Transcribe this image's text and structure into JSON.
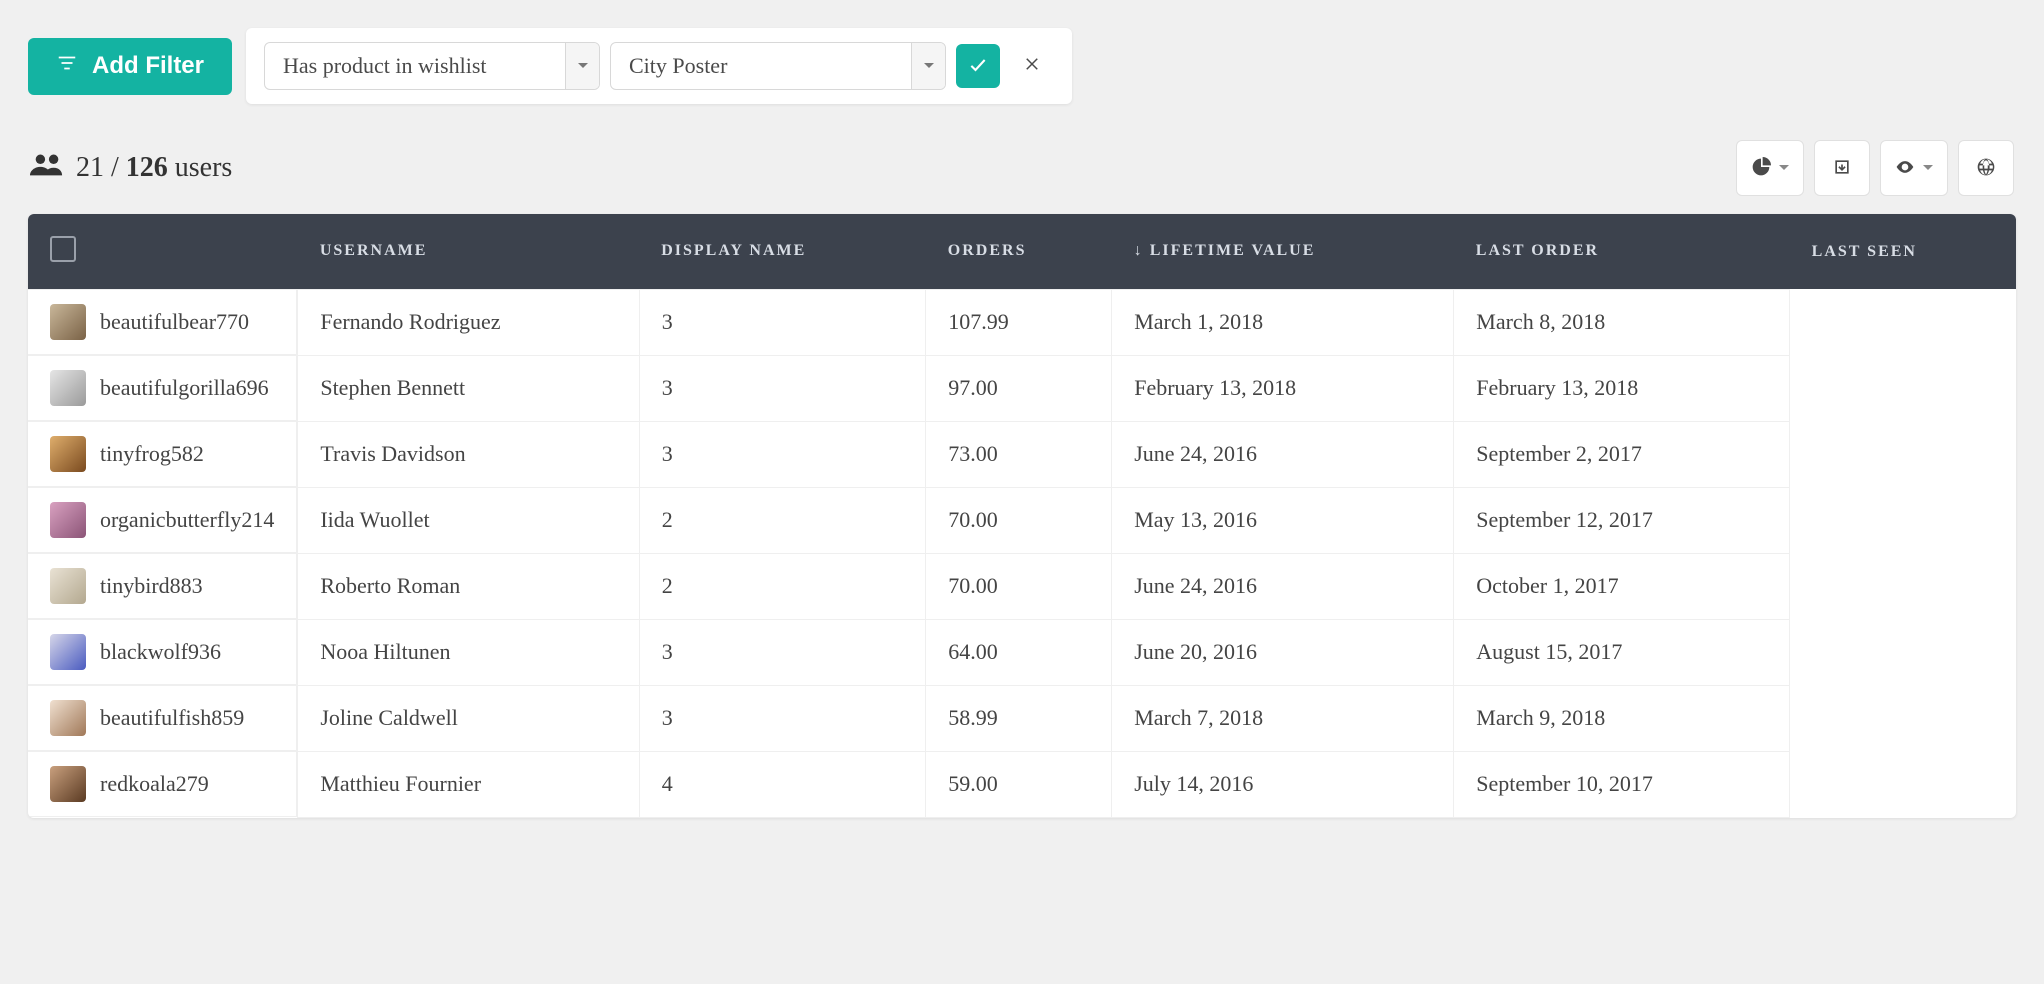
{
  "toolbar": {
    "add_filter_label": "Add Filter",
    "filter_field": "Has product in wishlist",
    "filter_value": "City Poster"
  },
  "summary": {
    "filtered": "21",
    "total": "126",
    "unit": "users"
  },
  "columns": {
    "username": "USERNAME",
    "display_name": "DISPLAY NAME",
    "orders": "ORDERS",
    "lifetime_value": "LIFETIME VALUE",
    "last_order": "LAST ORDER",
    "last_seen": "LAST SEEN",
    "sort_indicator": "↓"
  },
  "rows": [
    {
      "username": "beautifulbear770",
      "display_name": "Fernando Rodriguez",
      "orders": "3",
      "ltv": "107.99",
      "last_order": "March 1, 2018",
      "last_seen": "March 8, 2018"
    },
    {
      "username": "beautifulgorilla696",
      "display_name": "Stephen Bennett",
      "orders": "3",
      "ltv": "97.00",
      "last_order": "February 13, 2018",
      "last_seen": "February 13, 2018"
    },
    {
      "username": "tinyfrog582",
      "display_name": "Travis Davidson",
      "orders": "3",
      "ltv": "73.00",
      "last_order": "June 24, 2016",
      "last_seen": "September 2, 2017"
    },
    {
      "username": "organicbutterfly214",
      "display_name": "Iida Wuollet",
      "orders": "2",
      "ltv": "70.00",
      "last_order": "May 13, 2016",
      "last_seen": "September 12, 2017"
    },
    {
      "username": "tinybird883",
      "display_name": "Roberto Roman",
      "orders": "2",
      "ltv": "70.00",
      "last_order": "June 24, 2016",
      "last_seen": "October 1, 2017"
    },
    {
      "username": "blackwolf936",
      "display_name": "Nooa Hiltunen",
      "orders": "3",
      "ltv": "64.00",
      "last_order": "June 20, 2016",
      "last_seen": "August 15, 2017"
    },
    {
      "username": "beautifulfish859",
      "display_name": "Joline Caldwell",
      "orders": "3",
      "ltv": "58.99",
      "last_order": "March 7, 2018",
      "last_seen": "March 9, 2018"
    },
    {
      "username": "redkoala279",
      "display_name": "Matthieu Fournier",
      "orders": "4",
      "ltv": "59.00",
      "last_order": "July 14, 2016",
      "last_seen": "September 10, 2017"
    }
  ],
  "avatar_colors": [
    [
      "#c9b79a",
      "#7a6246"
    ],
    [
      "#e5e5e5",
      "#9a9a9a"
    ],
    [
      "#dfae6c",
      "#7a4a1f"
    ],
    [
      "#d9a1c0",
      "#8b5477"
    ],
    [
      "#e9e2d4",
      "#b3a88f"
    ],
    [
      "#d6d6e9",
      "#4a5bc0"
    ],
    [
      "#f0e0d0",
      "#a07858"
    ],
    [
      "#c9a07e",
      "#5a3a22"
    ]
  ]
}
